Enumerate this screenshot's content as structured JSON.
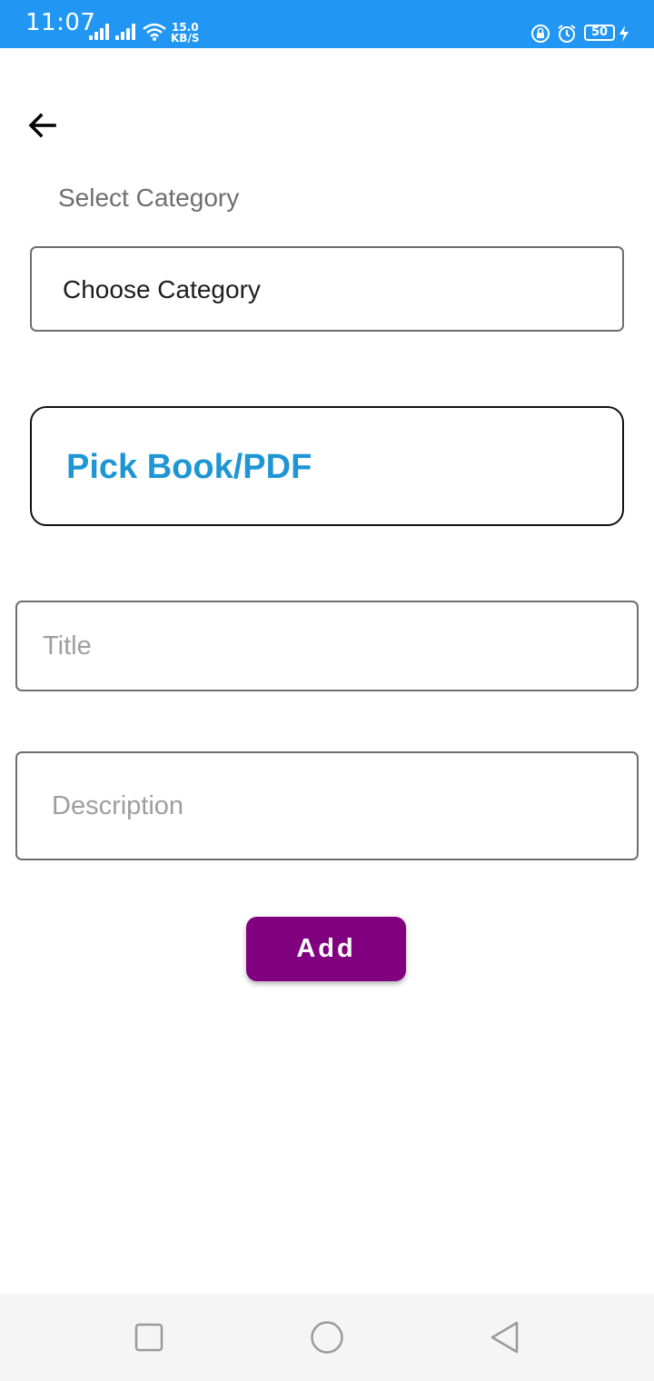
{
  "status_bar": {
    "time": "11:07",
    "net_speed_value": "15.0",
    "net_speed_unit": "KB/S",
    "battery_level": "50",
    "background_color": "#2196f3",
    "icons": [
      "signal-icon",
      "signal-icon",
      "wifi-icon",
      "lock-rotation-icon",
      "alarm-icon",
      "battery-icon",
      "charging-icon"
    ]
  },
  "header": {
    "back_icon": "arrow-left-icon"
  },
  "form": {
    "category_label": "Select Category",
    "category_select_value": "Choose Category",
    "pick_button_label": "Pick Book/PDF",
    "pick_button_color": "#1e96d4",
    "title_placeholder": "Title",
    "title_value": "",
    "description_placeholder": "Description",
    "description_value": "",
    "add_button_label": "Add",
    "add_button_color": "#800080"
  },
  "nav_bar": {
    "icons": [
      "recents-square-icon",
      "home-circle-icon",
      "back-triangle-icon"
    ]
  }
}
